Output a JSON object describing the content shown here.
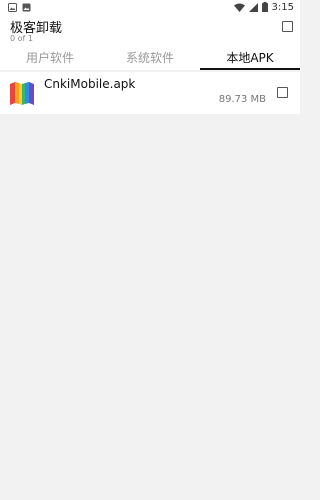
{
  "status_bar": {
    "time": "3:15"
  },
  "app_bar": {
    "title": "极客卸载",
    "subtitle": "0 of 1"
  },
  "tabs": [
    {
      "label": "用户软件",
      "active": false
    },
    {
      "label": "系统软件",
      "active": false
    },
    {
      "label": "本地APK",
      "active": true
    }
  ],
  "apk_list": [
    {
      "name": "CnkiMobile.apk",
      "size": "89.73 MB",
      "icon": "book-app-icon",
      "checked": false
    }
  ],
  "colors": {
    "background": "#f2f2f2",
    "surface": "#ffffff",
    "tab_active": "#111111",
    "tab_inactive": "#9a9a9a"
  }
}
